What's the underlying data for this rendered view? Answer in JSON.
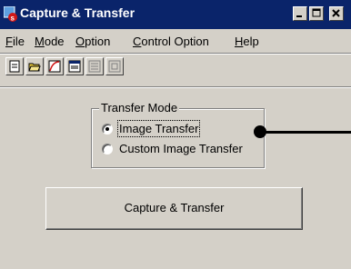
{
  "window": {
    "title": "Capture & Transfer"
  },
  "menu": {
    "items": [
      "File",
      "Mode",
      "Option",
      "Control Option",
      "Help"
    ]
  },
  "toolbar": {
    "icons": [
      "document-icon",
      "open-folder-icon",
      "red-curve-icon",
      "window-icon",
      "list-icon",
      "frame-icon"
    ]
  },
  "transfer_mode": {
    "legend": "Transfer Mode",
    "options": [
      {
        "label": "Image Transfer",
        "selected": true
      },
      {
        "label": "Custom Image Transfer",
        "selected": false
      }
    ]
  },
  "actions": {
    "capture_label": "Capture & Transfer"
  },
  "colors": {
    "titlebar": "#0a246a",
    "face": "#d4d0c8"
  }
}
